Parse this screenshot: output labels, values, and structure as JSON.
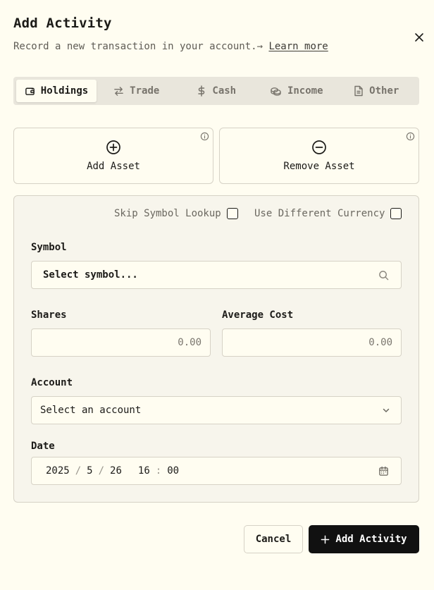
{
  "dialog": {
    "title": "Add Activity",
    "subtitle": "Record a new transaction in your account.",
    "arrow": "→",
    "learn_more": "Learn more"
  },
  "tabs": [
    {
      "label": "Holdings",
      "icon": "wallet-icon",
      "active": true
    },
    {
      "label": "Trade",
      "icon": "swap-arrows-icon",
      "active": false
    },
    {
      "label": "Cash",
      "icon": "dollar-icon",
      "active": false
    },
    {
      "label": "Income",
      "icon": "coins-icon",
      "active": false
    },
    {
      "label": "Other",
      "icon": "file-icon",
      "active": false
    }
  ],
  "cards": {
    "add": {
      "label": "Add Asset",
      "icon": "plus-circle-icon"
    },
    "remove": {
      "label": "Remove Asset",
      "icon": "minus-circle-icon"
    }
  },
  "options": {
    "skip_lookup": "Skip Symbol Lookup",
    "diff_currency": "Use Different Currency"
  },
  "form": {
    "symbol": {
      "label": "Symbol",
      "placeholder": "Select symbol..."
    },
    "shares": {
      "label": "Shares",
      "placeholder": "0.00"
    },
    "avg_cost": {
      "label": "Average Cost",
      "placeholder": "0.00"
    },
    "account": {
      "label": "Account",
      "placeholder": "Select an account"
    },
    "date": {
      "label": "Date",
      "year": "2025",
      "month": "5",
      "day": "26",
      "hour": "16",
      "minute": "00"
    }
  },
  "buttons": {
    "cancel": "Cancel",
    "submit": "Add Activity"
  },
  "colors": {
    "background": "#fffdf1",
    "panel": "#f7f5ec",
    "tabs_bg": "#e9e6dc",
    "primary_button": "#111111",
    "border": "#d6d2c6"
  }
}
